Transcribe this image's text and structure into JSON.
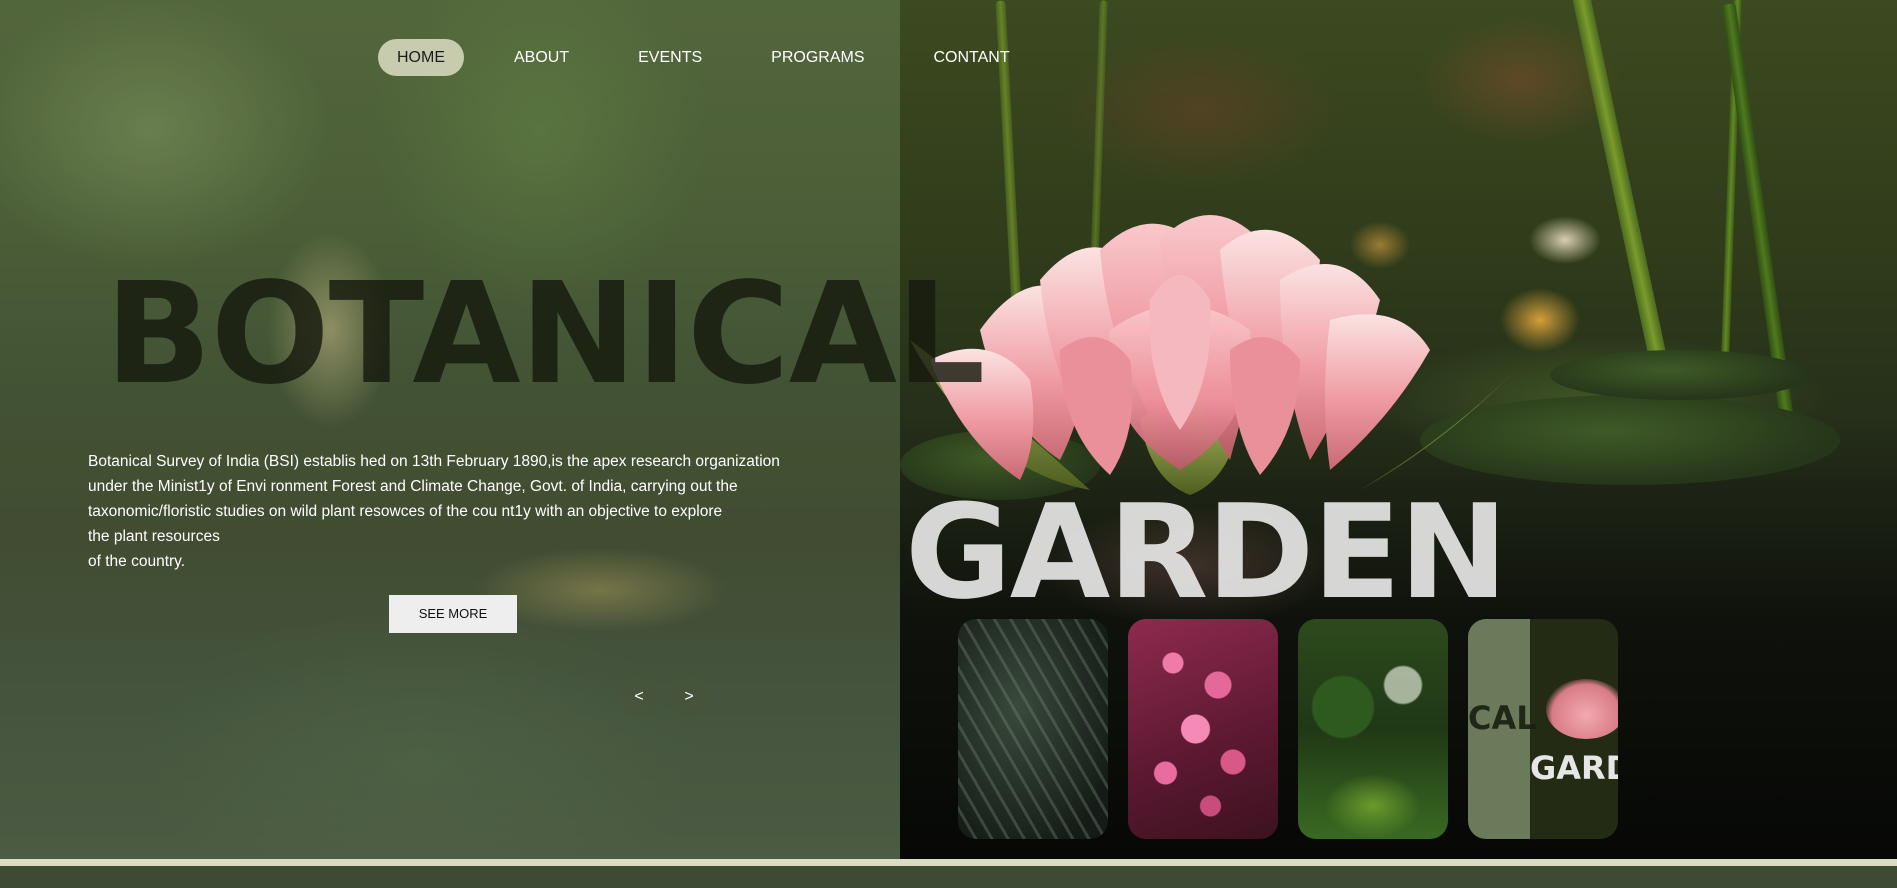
{
  "nav": {
    "items": [
      {
        "label": "HOME",
        "active": true
      },
      {
        "label": "ABOUT",
        "active": false
      },
      {
        "label": "EVENTS",
        "active": false
      },
      {
        "label": "PROGRAMS",
        "active": false
      },
      {
        "label": "CONTANT",
        "active": false
      }
    ]
  },
  "hero": {
    "title": "BOTANICAL",
    "description_lines": [
      "Botanical Survey of India (BSI) establis hed on 13th February 1890,is the apex research organization",
      "under the Minist1y of Envi ronment Forest and Climate Change, Govt. of India, carrying out the",
      "taxonomic/floristic studies on wild plant resowces of the cou nt1y with an objective to explore",
      "the plant resources",
      "of the country."
    ],
    "see_more_label": "SEE MORE",
    "prev_label": "<",
    "next_label": ">"
  },
  "feature": {
    "title": "GARDEN"
  },
  "thumbnails": {
    "items": [
      {
        "name": "palm-leaf"
      },
      {
        "name": "pink-blossom"
      },
      {
        "name": "green-garden"
      },
      {
        "name": "botanical-garden-preview",
        "text_1": "CAL",
        "text_2": "GARD"
      }
    ]
  },
  "colors": {
    "nav_active_bg": "#c7ccae",
    "footer_line": "#d9dcc3",
    "footer_band": "#3d4b35",
    "lotus_pink": "#f0a0a8"
  }
}
